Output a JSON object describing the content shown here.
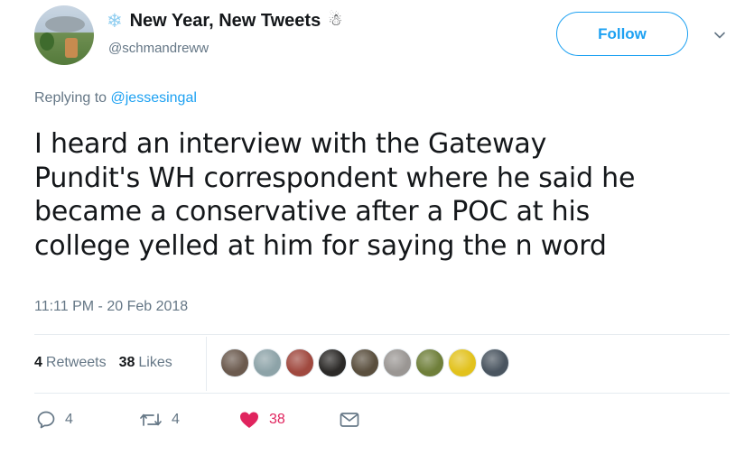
{
  "user": {
    "display_name": "New Year, New Tweets",
    "leading_emoji": "❄",
    "trailing_emoji": "☃",
    "handle": "@schmandreww",
    "avatar_icon": "avatar-photo"
  },
  "follow_button": {
    "label": "Follow"
  },
  "reply_context": {
    "prefix": "Replying to",
    "handle": "@jessesingal"
  },
  "tweet": {
    "text_lines": [
      "I heard an interview with the Gateway",
      "Pundit's WH correspondent where he said he",
      "became a conservative after a POC at his",
      "college yelled at him for saying the n word"
    ],
    "timestamp": "11:11 PM - 20 Feb 2018"
  },
  "stats": {
    "retweets_count": "4",
    "retweets_label": "Retweets",
    "likes_count": "38",
    "likes_label": "Likes"
  },
  "liker_avatars": [
    {
      "icon": "liker-avatar",
      "color": "#6b5a4e"
    },
    {
      "icon": "liker-avatar",
      "color": "#8da3a8"
    },
    {
      "icon": "liker-avatar",
      "color": "#a0493f"
    },
    {
      "icon": "liker-avatar",
      "color": "#2c2a28"
    },
    {
      "icon": "liker-avatar",
      "color": "#5a4f3e"
    },
    {
      "icon": "liker-avatar",
      "color": "#9a9693"
    },
    {
      "icon": "liker-avatar",
      "color": "#6f7f3a"
    },
    {
      "icon": "liker-avatar",
      "color": "#e2c21d"
    },
    {
      "icon": "liker-avatar",
      "color": "#4a5560"
    }
  ],
  "actions": {
    "reply": {
      "icon": "reply-icon",
      "count": "4"
    },
    "retweet": {
      "icon": "retweet-icon",
      "count": "4"
    },
    "like": {
      "icon": "heart-icon",
      "count": "38",
      "color": "#e0245e"
    },
    "message": {
      "icon": "envelope-icon"
    }
  },
  "colors": {
    "accent": "#1da1f2",
    "muted": "#657786",
    "like": "#e0245e",
    "text": "#14171a"
  }
}
